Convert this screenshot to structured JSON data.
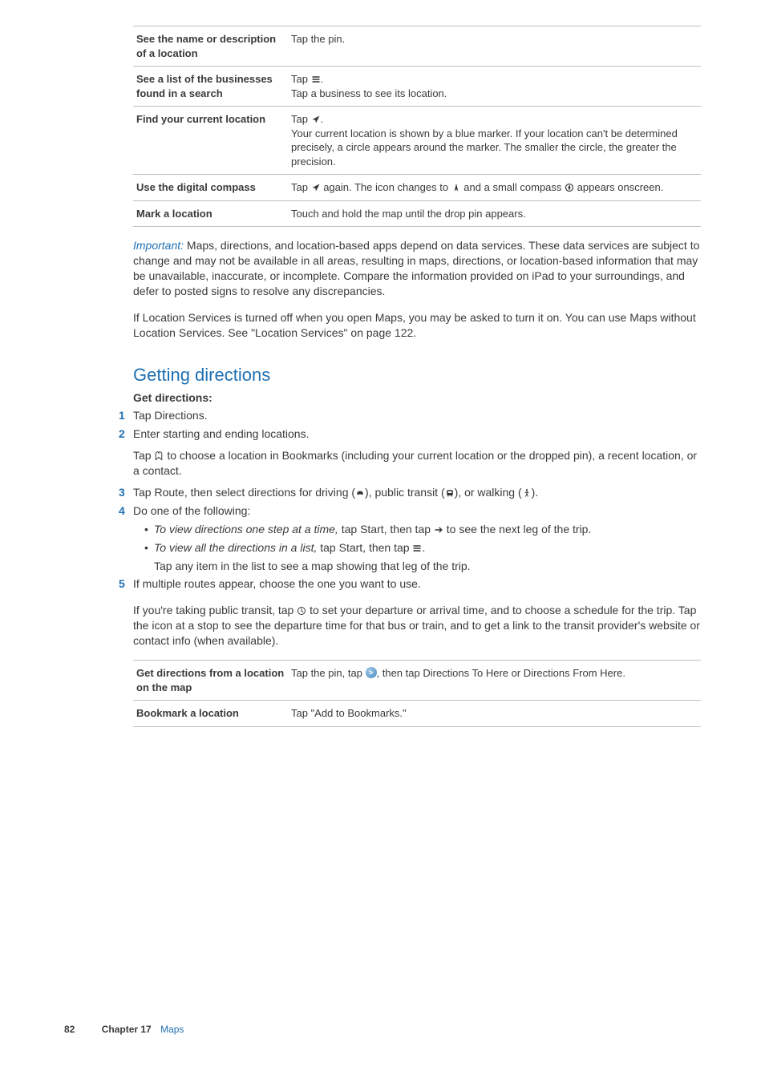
{
  "table1": {
    "rows": [
      {
        "left": "See the name or description of a location",
        "right": "Tap the pin."
      },
      {
        "left": "See a list of the businesses found in a search",
        "right_pre": "Tap ",
        "right_post": ".",
        "right_line2": "Tap a business to see its location."
      },
      {
        "left": "Find your current location",
        "right_pre": "Tap ",
        "right_post": ".",
        "right_para": "Your current location is shown by a blue marker. If your location can't be determined precisely, a circle appears around the marker. The smaller the circle, the greater the precision."
      },
      {
        "left": "Use the digital compass",
        "right_a": "Tap ",
        "right_b": " again. The icon changes to ",
        "right_c": " and a small compass ",
        "right_d": " appears onscreen."
      },
      {
        "left": "Mark a location",
        "right": "Touch and hold the map until the drop pin appears."
      }
    ]
  },
  "important_label": "Important:  ",
  "important_body": "Maps, directions, and location-based apps depend on data services. These data services are subject to change and may not be available in all areas, resulting in maps, directions, or location-based information that may be unavailable, inaccurate, or incomplete. Compare the information provided on iPad to your surroundings, and defer to posted signs to resolve any discrepancies.",
  "para_locservices": "If Location Services is turned off when you open Maps, you may be asked to turn it on. You can use Maps without Location Services. See \"Location Services\" on page 122.",
  "section_title": "Getting directions",
  "steps_title": "Get directions:",
  "steps": {
    "s1": "Tap Directions.",
    "s2": "Enter starting and ending locations.",
    "s2_body_a": "Tap ",
    "s2_body_b": " to choose a location in Bookmarks (including your current location or the dropped pin), a recent location, or a contact.",
    "s3_a": "Tap Route, then select directions for driving (",
    "s3_b": "), public transit (",
    "s3_c": "), or walking (",
    "s3_d": ").",
    "s4": "Do one of the following:",
    "s4_b1_label": "To view directions one step at a time, ",
    "s4_b1_text_a": "tap Start, then tap ",
    "s4_b1_text_b": " to see the next leg of the trip.",
    "s4_b2_label": "To view all the directions in a list, ",
    "s4_b2_text_a": "tap Start, then tap ",
    "s4_b2_text_b": ".",
    "s4_after": "Tap any item in the list to see a map showing that leg of the trip.",
    "s5": "If multiple routes appear, choose the one you want to use."
  },
  "transit_para_a": "If you're taking public transit, tap ",
  "transit_para_b": " to set your departure or arrival time, and to choose a schedule for the trip. Tap the icon at a stop to see the departure time for that bus or train, and to get a link to the transit provider's website or contact info (when available).",
  "table2": {
    "rows": [
      {
        "left": "Get directions from a location on the map",
        "right_a": "Tap the pin, tap ",
        "right_b": ", then tap Directions To Here or Directions From Here."
      },
      {
        "left": "Bookmark a location",
        "right": "Tap \"Add to Bookmarks.\""
      }
    ]
  },
  "footer": {
    "page_number": "82",
    "chapter_label": "Chapter 17",
    "chapter_title": "Maps"
  }
}
